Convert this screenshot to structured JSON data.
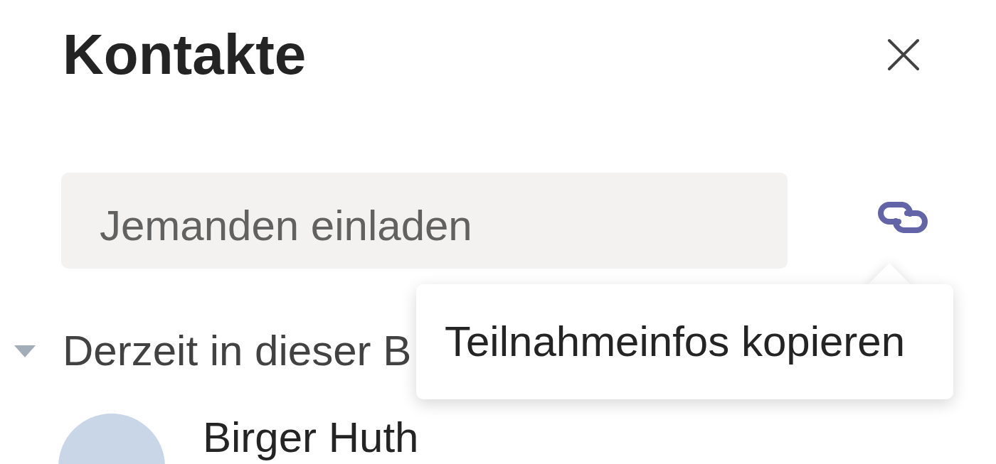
{
  "panel": {
    "title": "Kontakte"
  },
  "invite": {
    "placeholder": "Jemanden einladen"
  },
  "tooltip": {
    "text": "Teilnahmeinfos kopieren"
  },
  "sections": [
    {
      "label": "Derzeit in dieser B",
      "expanded": true,
      "people": [
        {
          "name": "Birger Huth"
        }
      ]
    }
  ]
}
